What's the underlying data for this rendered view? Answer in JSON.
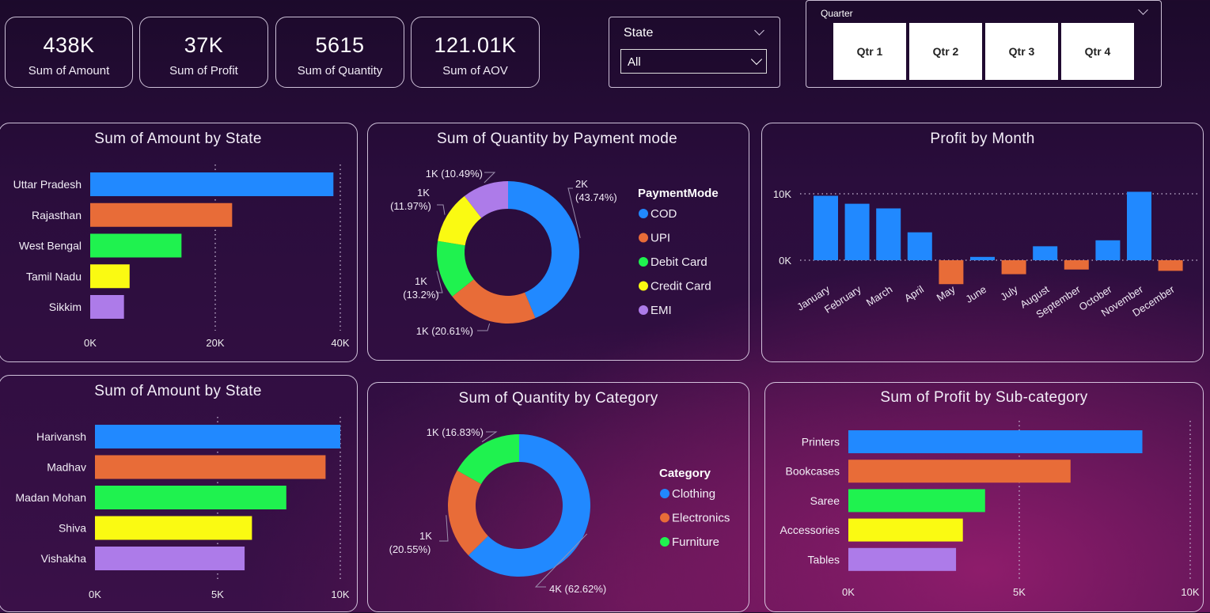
{
  "kpis": [
    {
      "value": "438K",
      "label": "Sum of Amount"
    },
    {
      "value": "37K",
      "label": "Sum of Profit"
    },
    {
      "value": "5615",
      "label": "Sum of Quantity"
    },
    {
      "value": "121.01K",
      "label": "Sum of AOV"
    }
  ],
  "state_slicer": {
    "title": "State",
    "selected": "All"
  },
  "quarter_slicer": {
    "title": "Quarter",
    "options": [
      "Qtr 1",
      "Qtr 2",
      "Qtr 3",
      "Qtr 4"
    ]
  },
  "colors": {
    "blue": "#2189ff",
    "orange": "#e86c38",
    "green": "#1ff24f",
    "yellow": "#fafa12",
    "purple": "#ad7be9"
  },
  "chart_data": [
    {
      "id": "amount_by_state",
      "type": "bar",
      "orientation": "horizontal",
      "title": "Sum of Amount by State",
      "categories": [
        "Uttar Pradesh",
        "Rajasthan",
        "West Bengal",
        "Tamil Nadu",
        "Sikkim"
      ],
      "values": [
        38900,
        22700,
        14600,
        6300,
        5400
      ],
      "xlim": [
        0,
        40000
      ],
      "ticks": [
        "0K",
        "20K",
        "40K"
      ]
    },
    {
      "id": "quantity_by_payment",
      "type": "pie",
      "donut": true,
      "title": "Sum of Quantity by Payment mode",
      "legend_title": "PaymentMode",
      "labels": [
        "COD",
        "UPI",
        "Debit Card",
        "Credit Card",
        "EMI"
      ],
      "values": [
        43.74,
        20.61,
        13.2,
        11.97,
        10.49
      ],
      "data_labels": [
        "2K (43.74%)",
        "1K (20.61%)",
        "1K (13.2%)",
        "1K (11.97%)",
        "1K (10.49%)"
      ]
    },
    {
      "id": "profit_by_month",
      "type": "bar",
      "orientation": "vertical",
      "title": "Profit by Month",
      "categories": [
        "January",
        "February",
        "March",
        "April",
        "May",
        "June",
        "July",
        "August",
        "September",
        "October",
        "November",
        "December"
      ],
      "values": [
        9700,
        8500,
        7800,
        4200,
        -3600,
        500,
        -2100,
        2100,
        -1400,
        3000,
        10300,
        -1600
      ],
      "ylim": [
        -4000,
        12000
      ],
      "ticks": [
        "0K",
        "10K"
      ]
    },
    {
      "id": "amount_by_customer",
      "type": "bar",
      "orientation": "horizontal",
      "title": "Sum of Amount by State",
      "categories": [
        "Harivansh",
        "Madhav",
        "Madan Mohan",
        "Shiva",
        "Vishakha"
      ],
      "values": [
        10000,
        9400,
        7800,
        6400,
        6100
      ],
      "xlim": [
        0,
        10000
      ],
      "ticks": [
        "0K",
        "5K",
        "10K"
      ]
    },
    {
      "id": "quantity_by_category",
      "type": "pie",
      "donut": true,
      "title": "Sum of Quantity by Category",
      "legend_title": "Category",
      "labels": [
        "Clothing",
        "Electronics",
        "Furniture"
      ],
      "values": [
        62.62,
        20.55,
        16.83
      ],
      "data_labels": [
        "4K (62.62%)",
        "1K (20.55%)",
        "1K (16.83%)"
      ]
    },
    {
      "id": "profit_by_subcategory",
      "type": "bar",
      "orientation": "horizontal",
      "title": "Sum of Profit by Sub-category",
      "categories": [
        "Printers",
        "Bookcases",
        "Saree",
        "Accessories",
        "Tables"
      ],
      "values": [
        8600,
        6500,
        4000,
        3350,
        3150
      ],
      "xlim": [
        0,
        10000
      ],
      "ticks": [
        "0K",
        "5K",
        "10K"
      ]
    }
  ]
}
